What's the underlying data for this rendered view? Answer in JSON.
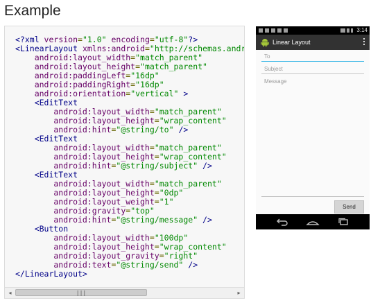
{
  "heading": "Example",
  "code": {
    "lines": [
      [
        {
          "t": "<?xml ",
          "c": "dec"
        },
        {
          "t": "version",
          "c": "attr"
        },
        {
          "t": "=",
          "c": "pun"
        },
        {
          "t": "\"1.0\"",
          "c": "val"
        },
        {
          "t": " encoding",
          "c": "attr"
        },
        {
          "t": "=",
          "c": "pun"
        },
        {
          "t": "\"utf-8\"",
          "c": "val"
        },
        {
          "t": "?>",
          "c": "dec"
        }
      ],
      [
        {
          "t": "<LinearLayout",
          "c": "tag"
        },
        {
          "t": " xmlns:android",
          "c": "attr"
        },
        {
          "t": "=",
          "c": "pun"
        },
        {
          "t": "\"http://schemas.android.com/apk/res/android\"",
          "c": "val"
        }
      ],
      [
        {
          "t": "    android:layout_width",
          "c": "attr"
        },
        {
          "t": "=",
          "c": "pun"
        },
        {
          "t": "\"match_parent\"",
          "c": "val"
        }
      ],
      [
        {
          "t": "    android:layout_height",
          "c": "attr"
        },
        {
          "t": "=",
          "c": "pun"
        },
        {
          "t": "\"match_parent\"",
          "c": "val"
        }
      ],
      [
        {
          "t": "    android:paddingLeft",
          "c": "attr"
        },
        {
          "t": "=",
          "c": "pun"
        },
        {
          "t": "\"16dp\"",
          "c": "val"
        }
      ],
      [
        {
          "t": "    android:paddingRight",
          "c": "attr"
        },
        {
          "t": "=",
          "c": "pun"
        },
        {
          "t": "\"16dp\"",
          "c": "val"
        }
      ],
      [
        {
          "t": "    android:orientation",
          "c": "attr"
        },
        {
          "t": "=",
          "c": "pun"
        },
        {
          "t": "\"vertical\"",
          "c": "val"
        },
        {
          "t": " >",
          "c": "tag"
        }
      ],
      [
        {
          "t": "    <EditText",
          "c": "tag"
        }
      ],
      [
        {
          "t": "        android:layout_width",
          "c": "attr"
        },
        {
          "t": "=",
          "c": "pun"
        },
        {
          "t": "\"match_parent\"",
          "c": "val"
        }
      ],
      [
        {
          "t": "        android:layout_height",
          "c": "attr"
        },
        {
          "t": "=",
          "c": "pun"
        },
        {
          "t": "\"wrap_content\"",
          "c": "val"
        }
      ],
      [
        {
          "t": "        android:hint",
          "c": "attr"
        },
        {
          "t": "=",
          "c": "pun"
        },
        {
          "t": "\"@string/to\"",
          "c": "val"
        },
        {
          "t": " />",
          "c": "tag"
        }
      ],
      [
        {
          "t": "    <EditText",
          "c": "tag"
        }
      ],
      [
        {
          "t": "        android:layout_width",
          "c": "attr"
        },
        {
          "t": "=",
          "c": "pun"
        },
        {
          "t": "\"match_parent\"",
          "c": "val"
        }
      ],
      [
        {
          "t": "        android:layout_height",
          "c": "attr"
        },
        {
          "t": "=",
          "c": "pun"
        },
        {
          "t": "\"wrap_content\"",
          "c": "val"
        }
      ],
      [
        {
          "t": "        android:hint",
          "c": "attr"
        },
        {
          "t": "=",
          "c": "pun"
        },
        {
          "t": "\"@string/subject\"",
          "c": "val"
        },
        {
          "t": " />",
          "c": "tag"
        }
      ],
      [
        {
          "t": "    <EditText",
          "c": "tag"
        }
      ],
      [
        {
          "t": "        android:layout_width",
          "c": "attr"
        },
        {
          "t": "=",
          "c": "pun"
        },
        {
          "t": "\"match_parent\"",
          "c": "val"
        }
      ],
      [
        {
          "t": "        android:layout_height",
          "c": "attr"
        },
        {
          "t": "=",
          "c": "pun"
        },
        {
          "t": "\"0dp\"",
          "c": "val"
        }
      ],
      [
        {
          "t": "        android:layout_weight",
          "c": "attr"
        },
        {
          "t": "=",
          "c": "pun"
        },
        {
          "t": "\"1\"",
          "c": "val"
        }
      ],
      [
        {
          "t": "        android:gravity",
          "c": "attr"
        },
        {
          "t": "=",
          "c": "pun"
        },
        {
          "t": "\"top\"",
          "c": "val"
        }
      ],
      [
        {
          "t": "        android:hint",
          "c": "attr"
        },
        {
          "t": "=",
          "c": "pun"
        },
        {
          "t": "\"@string/message\"",
          "c": "val"
        },
        {
          "t": " />",
          "c": "tag"
        }
      ],
      [
        {
          "t": "    <Button",
          "c": "tag"
        }
      ],
      [
        {
          "t": "        android:layout_width",
          "c": "attr"
        },
        {
          "t": "=",
          "c": "pun"
        },
        {
          "t": "\"100dp\"",
          "c": "val"
        }
      ],
      [
        {
          "t": "        android:layout_height",
          "c": "attr"
        },
        {
          "t": "=",
          "c": "pun"
        },
        {
          "t": "\"wrap_content\"",
          "c": "val"
        }
      ],
      [
        {
          "t": "        android:layout_gravity",
          "c": "attr"
        },
        {
          "t": "=",
          "c": "pun"
        },
        {
          "t": "\"right\"",
          "c": "val"
        }
      ],
      [
        {
          "t": "        android:text",
          "c": "attr"
        },
        {
          "t": "=",
          "c": "pun"
        },
        {
          "t": "\"@string/send\"",
          "c": "val"
        },
        {
          "t": " />",
          "c": "tag"
        }
      ],
      [
        {
          "t": "</LinearLayout>",
          "c": "tag"
        }
      ]
    ],
    "scrollbar": {
      "left_arrow": "◂",
      "right_arrow": "▸",
      "thumb_grip": "|||"
    }
  },
  "phone": {
    "status_bar": {
      "time": "3:14"
    },
    "action_bar": {
      "title": "Linear Layout",
      "icon": "android-icon",
      "menu_icon": "overflow-menu-icon"
    },
    "fields": {
      "to_hint": "To",
      "subject_hint": "Subject",
      "message_hint": "Message"
    },
    "send_label": "Send",
    "nav_icons": [
      "back-icon",
      "home-icon",
      "recents-icon"
    ],
    "colors": {
      "focus_accent": "#33b5e5",
      "action_bar": "#323232"
    }
  }
}
